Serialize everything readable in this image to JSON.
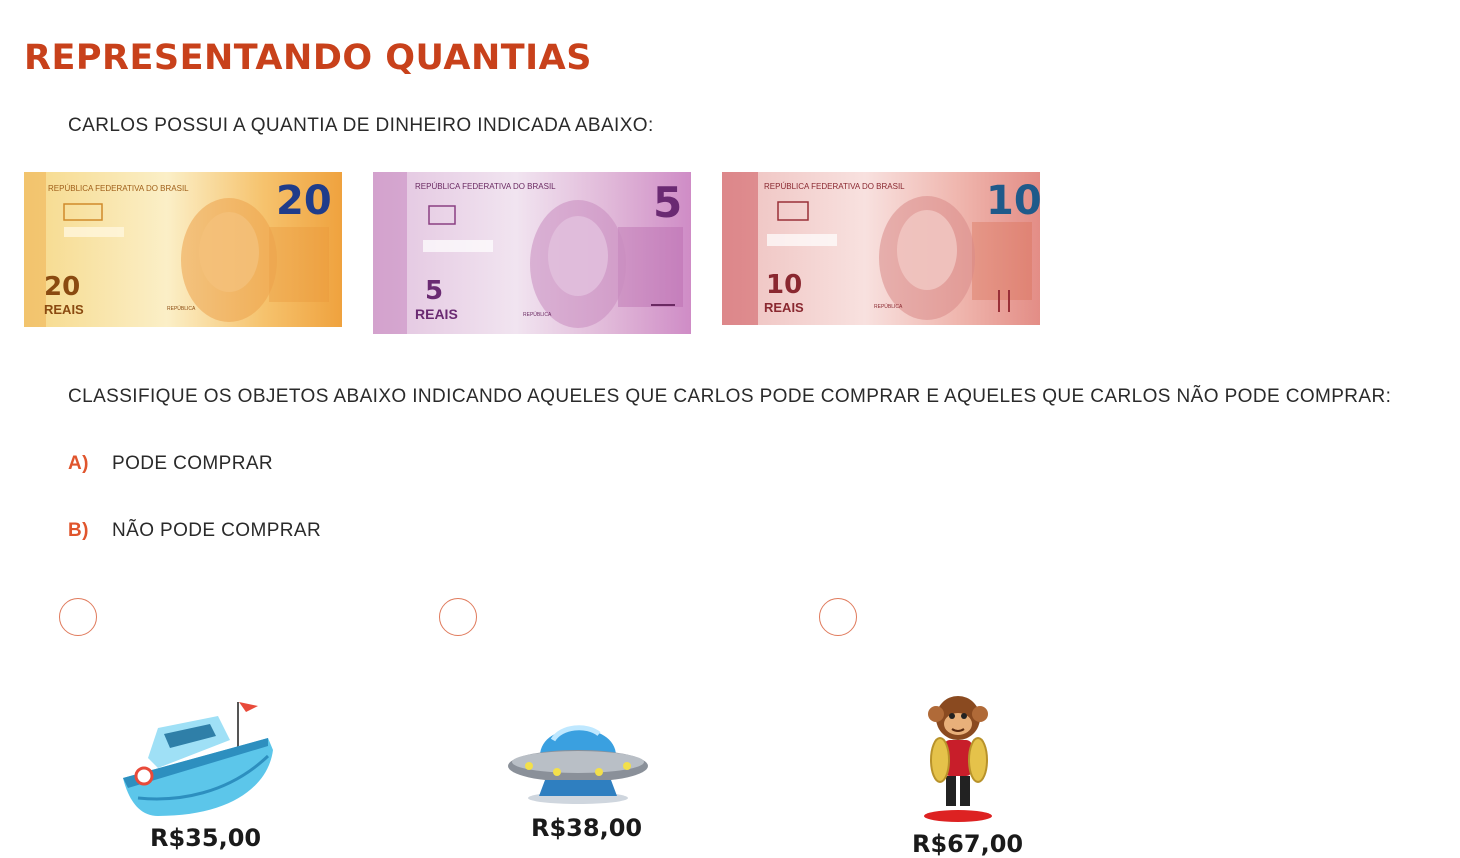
{
  "title": "REPRESENTANDO QUANTIAS",
  "intro": "CARLOS POSSUI A QUANTIA DE DINHEIRO INDICADA ABAIXO:",
  "notes": [
    {
      "header": "REPÚBLICA FEDERATIVA DO BRASIL",
      "denomination": "20",
      "small": "20",
      "unit": "REAIS",
      "footer": "REPÚBLICA",
      "color": "#f2b24a"
    },
    {
      "header": "REPÚBLICA FEDERATIVA DO BRASIL",
      "denomination": "5",
      "small": "5",
      "unit": "REAIS",
      "footer": "REPÚBLICA",
      "color": "#b06aa8"
    },
    {
      "header": "REPÚBLICA FEDERATIVA DO BRASIL",
      "denomination": "10",
      "small": "10",
      "unit": "REAIS",
      "footer": "REPÚBLICA",
      "color": "#d9676a"
    }
  ],
  "instruction": "CLASSIFIQUE OS OBJETOS ABAIXO INDICANDO AQUELES QUE CARLOS PODE COMPRAR E AQUELES QUE CARLOS NÃO PODE COMPRAR:",
  "options": [
    {
      "letter": "A)",
      "label": "PODE COMPRAR"
    },
    {
      "letter": "B)",
      "label": "NÃO PODE COMPRAR"
    }
  ],
  "products": [
    {
      "icon": "boat-icon",
      "price": "R$35,00"
    },
    {
      "icon": "ufo-icon",
      "price": "R$38,00"
    },
    {
      "icon": "monkey-cymbals-icon",
      "price": "R$67,00"
    }
  ],
  "colors": {
    "title": "#c8411b",
    "accent": "#e0552d",
    "radio_border": "#e07b5d"
  }
}
